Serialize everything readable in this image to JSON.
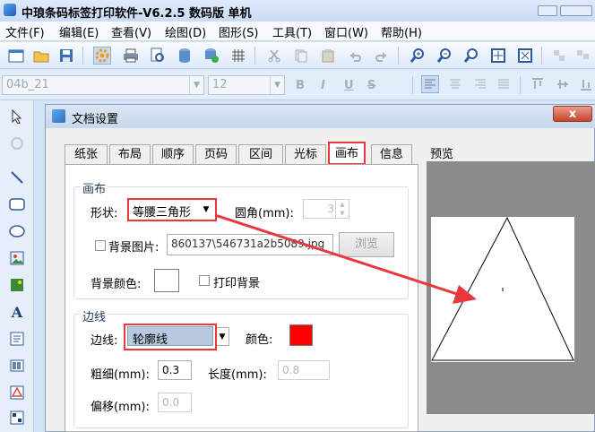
{
  "window": {
    "title": "中琅条码标签打印软件-V6.2.5 数码版 单机"
  },
  "menu": [
    "文件(F)",
    "编辑(E)",
    "查看(V)",
    "绘图(D)",
    "图形(S)",
    "工具(T)",
    "窗口(W)",
    "帮助(H)"
  ],
  "format_bar": {
    "font_name": "04b_21",
    "font_size": "12",
    "bold": "B",
    "italic": "I",
    "underline": "U",
    "strike": "S"
  },
  "dialog": {
    "title": "文档设置",
    "close_symbol": "x",
    "tabs": [
      "纸张",
      "布局",
      "顺序",
      "页码",
      "区间",
      "光标",
      "画布",
      "信息"
    ],
    "active_tab": "画布",
    "canvas_group": {
      "label": "画布",
      "shape_label": "形状:",
      "shape_value": "等腰三角形",
      "corner_label": "圆角(mm):",
      "corner_value": "3",
      "bg_image_label": "背景图片:",
      "bg_image_value": "860137\\546731a2b5089.jpg",
      "browse_label": "浏览",
      "bg_color_label": "背景颜色:",
      "print_bg_label": "打印背景"
    },
    "border_group": {
      "label": "边线",
      "line_label": "边线:",
      "line_value": "轮廓线",
      "color_label": "颜色:",
      "thickness_label": "粗细(mm):",
      "thickness_value": "0.3",
      "length_label": "长度(mm):",
      "length_value": "0.8",
      "offset_label": "偏移(mm):",
      "offset_value": "0.0"
    },
    "preview_label": "预览"
  },
  "colors": {
    "highlight": "#e8383d",
    "border_color": "#ff0000",
    "accent": "#2f6dbf"
  }
}
